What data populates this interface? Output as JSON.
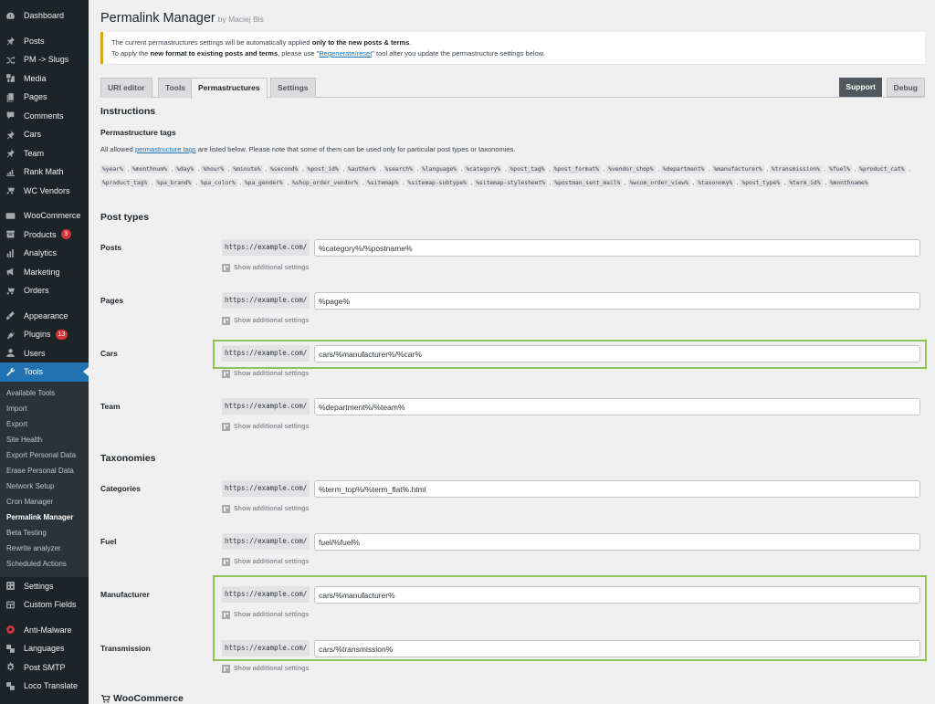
{
  "sidebar": {
    "items": [
      {
        "label": "Dashboard",
        "icon": "dashboard-icon"
      },
      {
        "label": "Posts",
        "icon": "pin-icon"
      },
      {
        "label": "PM -> Slugs",
        "icon": "shuffle-icon"
      },
      {
        "label": "Media",
        "icon": "media-icon"
      },
      {
        "label": "Pages",
        "icon": "pages-icon"
      },
      {
        "label": "Comments",
        "icon": "comments-icon"
      },
      {
        "label": "Cars",
        "icon": "pin-icon"
      },
      {
        "label": "Team",
        "icon": "pin-icon"
      },
      {
        "label": "Rank Math",
        "icon": "chart-icon"
      },
      {
        "label": "WC Vendors",
        "icon": "cart-icon"
      },
      {
        "label": "WooCommerce",
        "icon": "woo-icon"
      },
      {
        "label": "Products",
        "icon": "archive-icon",
        "badge": "3"
      },
      {
        "label": "Analytics",
        "icon": "bar-chart-icon"
      },
      {
        "label": "Marketing",
        "icon": "megaphone-icon"
      },
      {
        "label": "Orders",
        "icon": "cart-icon"
      },
      {
        "label": "Appearance",
        "icon": "brush-icon"
      },
      {
        "label": "Plugins",
        "icon": "plug-icon",
        "badge": "13"
      },
      {
        "label": "Users",
        "icon": "user-icon"
      },
      {
        "label": "Tools",
        "icon": "wrench-icon"
      },
      {
        "label": "Settings",
        "icon": "sliders-icon"
      },
      {
        "label": "Custom Fields",
        "icon": "grid-icon"
      },
      {
        "label": "Anti-Malware",
        "icon": "shield-icon"
      },
      {
        "label": "Languages",
        "icon": "translate-icon"
      },
      {
        "label": "Post SMTP",
        "icon": "gear-icon"
      },
      {
        "label": "Loco Translate",
        "icon": "translate-icon"
      }
    ],
    "tools_submenu": [
      "Available Tools",
      "Import",
      "Export",
      "Site Health",
      "Export Personal Data",
      "Erase Personal Data",
      "Network Setup",
      "Cron Manager",
      "Permalink Manager",
      "Beta Testing",
      "Rewrite analyzer",
      "Scheduled Actions"
    ],
    "current_submenu": "Permalink Manager"
  },
  "header": {
    "title": "Permalink Manager",
    "byline": "by Maciej Bis"
  },
  "notice": {
    "line1_pre": "The current permastructures settings will be automatically applied ",
    "line1_bold": "only to the new posts & terms",
    "line1_post": ".",
    "line2_pre": "To apply the ",
    "line2_bold": "new format to existing posts and terms",
    "line2_mid": ", please use \"",
    "line2_link": "Regenerate/reset",
    "line2_post": "\" tool after you update the permastructure settings below."
  },
  "tabs": [
    {
      "label": "URI editor",
      "active": false
    },
    {
      "label": "Tools",
      "active": false
    },
    {
      "label": "Permastructures",
      "active": true
    },
    {
      "label": "Settings",
      "active": false
    }
  ],
  "buttons": {
    "support": "Support",
    "debug": "Debug"
  },
  "instructions": {
    "heading": "Instructions",
    "subheading": "Permastructure tags",
    "desc_pre": "All allowed ",
    "desc_link": "permastructure tags",
    "desc_post": " are listed below. Please note that some of them can be used only for particular post types or taxonomies.",
    "tags": [
      "%year%",
      "%monthnum%",
      "%day%",
      "%hour%",
      "%minute%",
      "%second%",
      "%post_id%",
      "%author%",
      "%search%",
      "%language%",
      "%category%",
      "%post_tag%",
      "%post_format%",
      "%vendor_shop%",
      "%department%",
      "%manufacturer%",
      "%transmission%",
      "%fuel%",
      "%product_cat%",
      "%product_tag%",
      "%pa_brand%",
      "%pa_color%",
      "%pa_gender%",
      "%shop_order_vendor%",
      "%sitemap%",
      "%sitemap-subtype%",
      "%sitemap-stylesheet%",
      "%postman_sent_mail%",
      "%wcom_order_view%",
      "%taxonomy%",
      "%post_type%",
      "%term_id%",
      "%monthname%"
    ]
  },
  "post_types": {
    "heading": "Post types",
    "rows": [
      {
        "label": "Posts",
        "prefix": "https://example.com/",
        "value": "%category%/%postname%",
        "more": "Show additional settings"
      },
      {
        "label": "Pages",
        "prefix": "https://example.com/",
        "value": "%page%",
        "more": "Show additional settings"
      },
      {
        "label": "Cars",
        "prefix": "https://example.com/",
        "value": "cars/%manufacturer%/%car%",
        "more": "Show additional settings",
        "highlighted": true
      },
      {
        "label": "Team",
        "prefix": "https://example.com/",
        "value": "%department%/%team%",
        "more": "Show additional settings"
      }
    ]
  },
  "taxonomies": {
    "heading": "Taxonomies",
    "rows": [
      {
        "label": "Categories",
        "prefix": "https://example.com/",
        "value": "%term_top%/%term_flat%.html",
        "more": "Show additional settings"
      },
      {
        "label": "Fuel",
        "prefix": "https://example.com/",
        "value": "fuel/%fuel%",
        "more": "Show additional settings"
      },
      {
        "label": "Manufacturer",
        "prefix": "https://example.com/",
        "value": "cars/%manufacturer%",
        "more": "Show additional settings",
        "highlighted": true
      },
      {
        "label": "Transmission",
        "prefix": "https://example.com/",
        "value": "cars/%transmission%",
        "more": "Show additional settings",
        "highlighted": true
      }
    ]
  },
  "woocommerce": {
    "heading": "WooCommerce"
  },
  "colors": {
    "highlight": "#8cc456",
    "accent": "#2271b1",
    "notice_border": "#dba617",
    "badge": "#d63638"
  }
}
